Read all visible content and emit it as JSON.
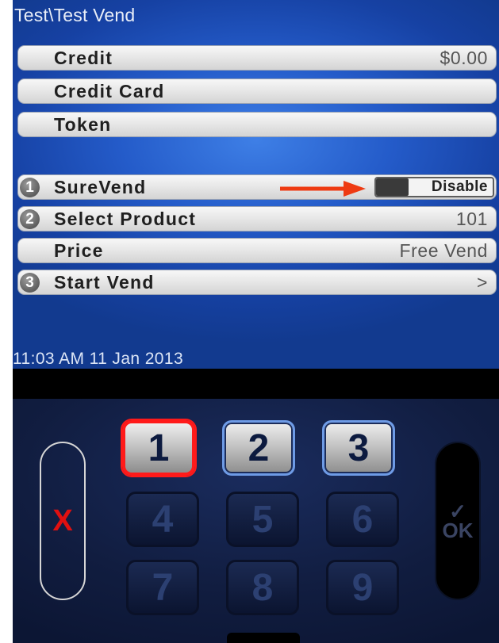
{
  "screen": {
    "title": "Test\\Test Vend",
    "datetime": "11:03 AM 11 Jan 2013",
    "payment_rows": [
      {
        "label": "Credit",
        "value": "$0.00"
      },
      {
        "label": "Credit Card",
        "value": ""
      },
      {
        "label": "Token",
        "value": ""
      }
    ],
    "steps": [
      {
        "number": "1",
        "label": "SureVend",
        "toggle_label": "Disable"
      },
      {
        "number": "2",
        "label": "Select Product",
        "value": "101"
      },
      {
        "number": "",
        "label": "Price",
        "value": "Free Vend"
      },
      {
        "number": "3",
        "label": "Start Vend",
        "value": ">"
      }
    ]
  },
  "keypad": {
    "cancel": "X",
    "ok": "OK",
    "ok_check": "✓",
    "keys": [
      "1",
      "2",
      "3",
      "4",
      "5",
      "6",
      "7",
      "8",
      "9"
    ]
  },
  "colors": {
    "screen_blue": "#245bc9",
    "annotation_red": "#ff1a1a",
    "arrow_orange": "#ee3a12"
  }
}
